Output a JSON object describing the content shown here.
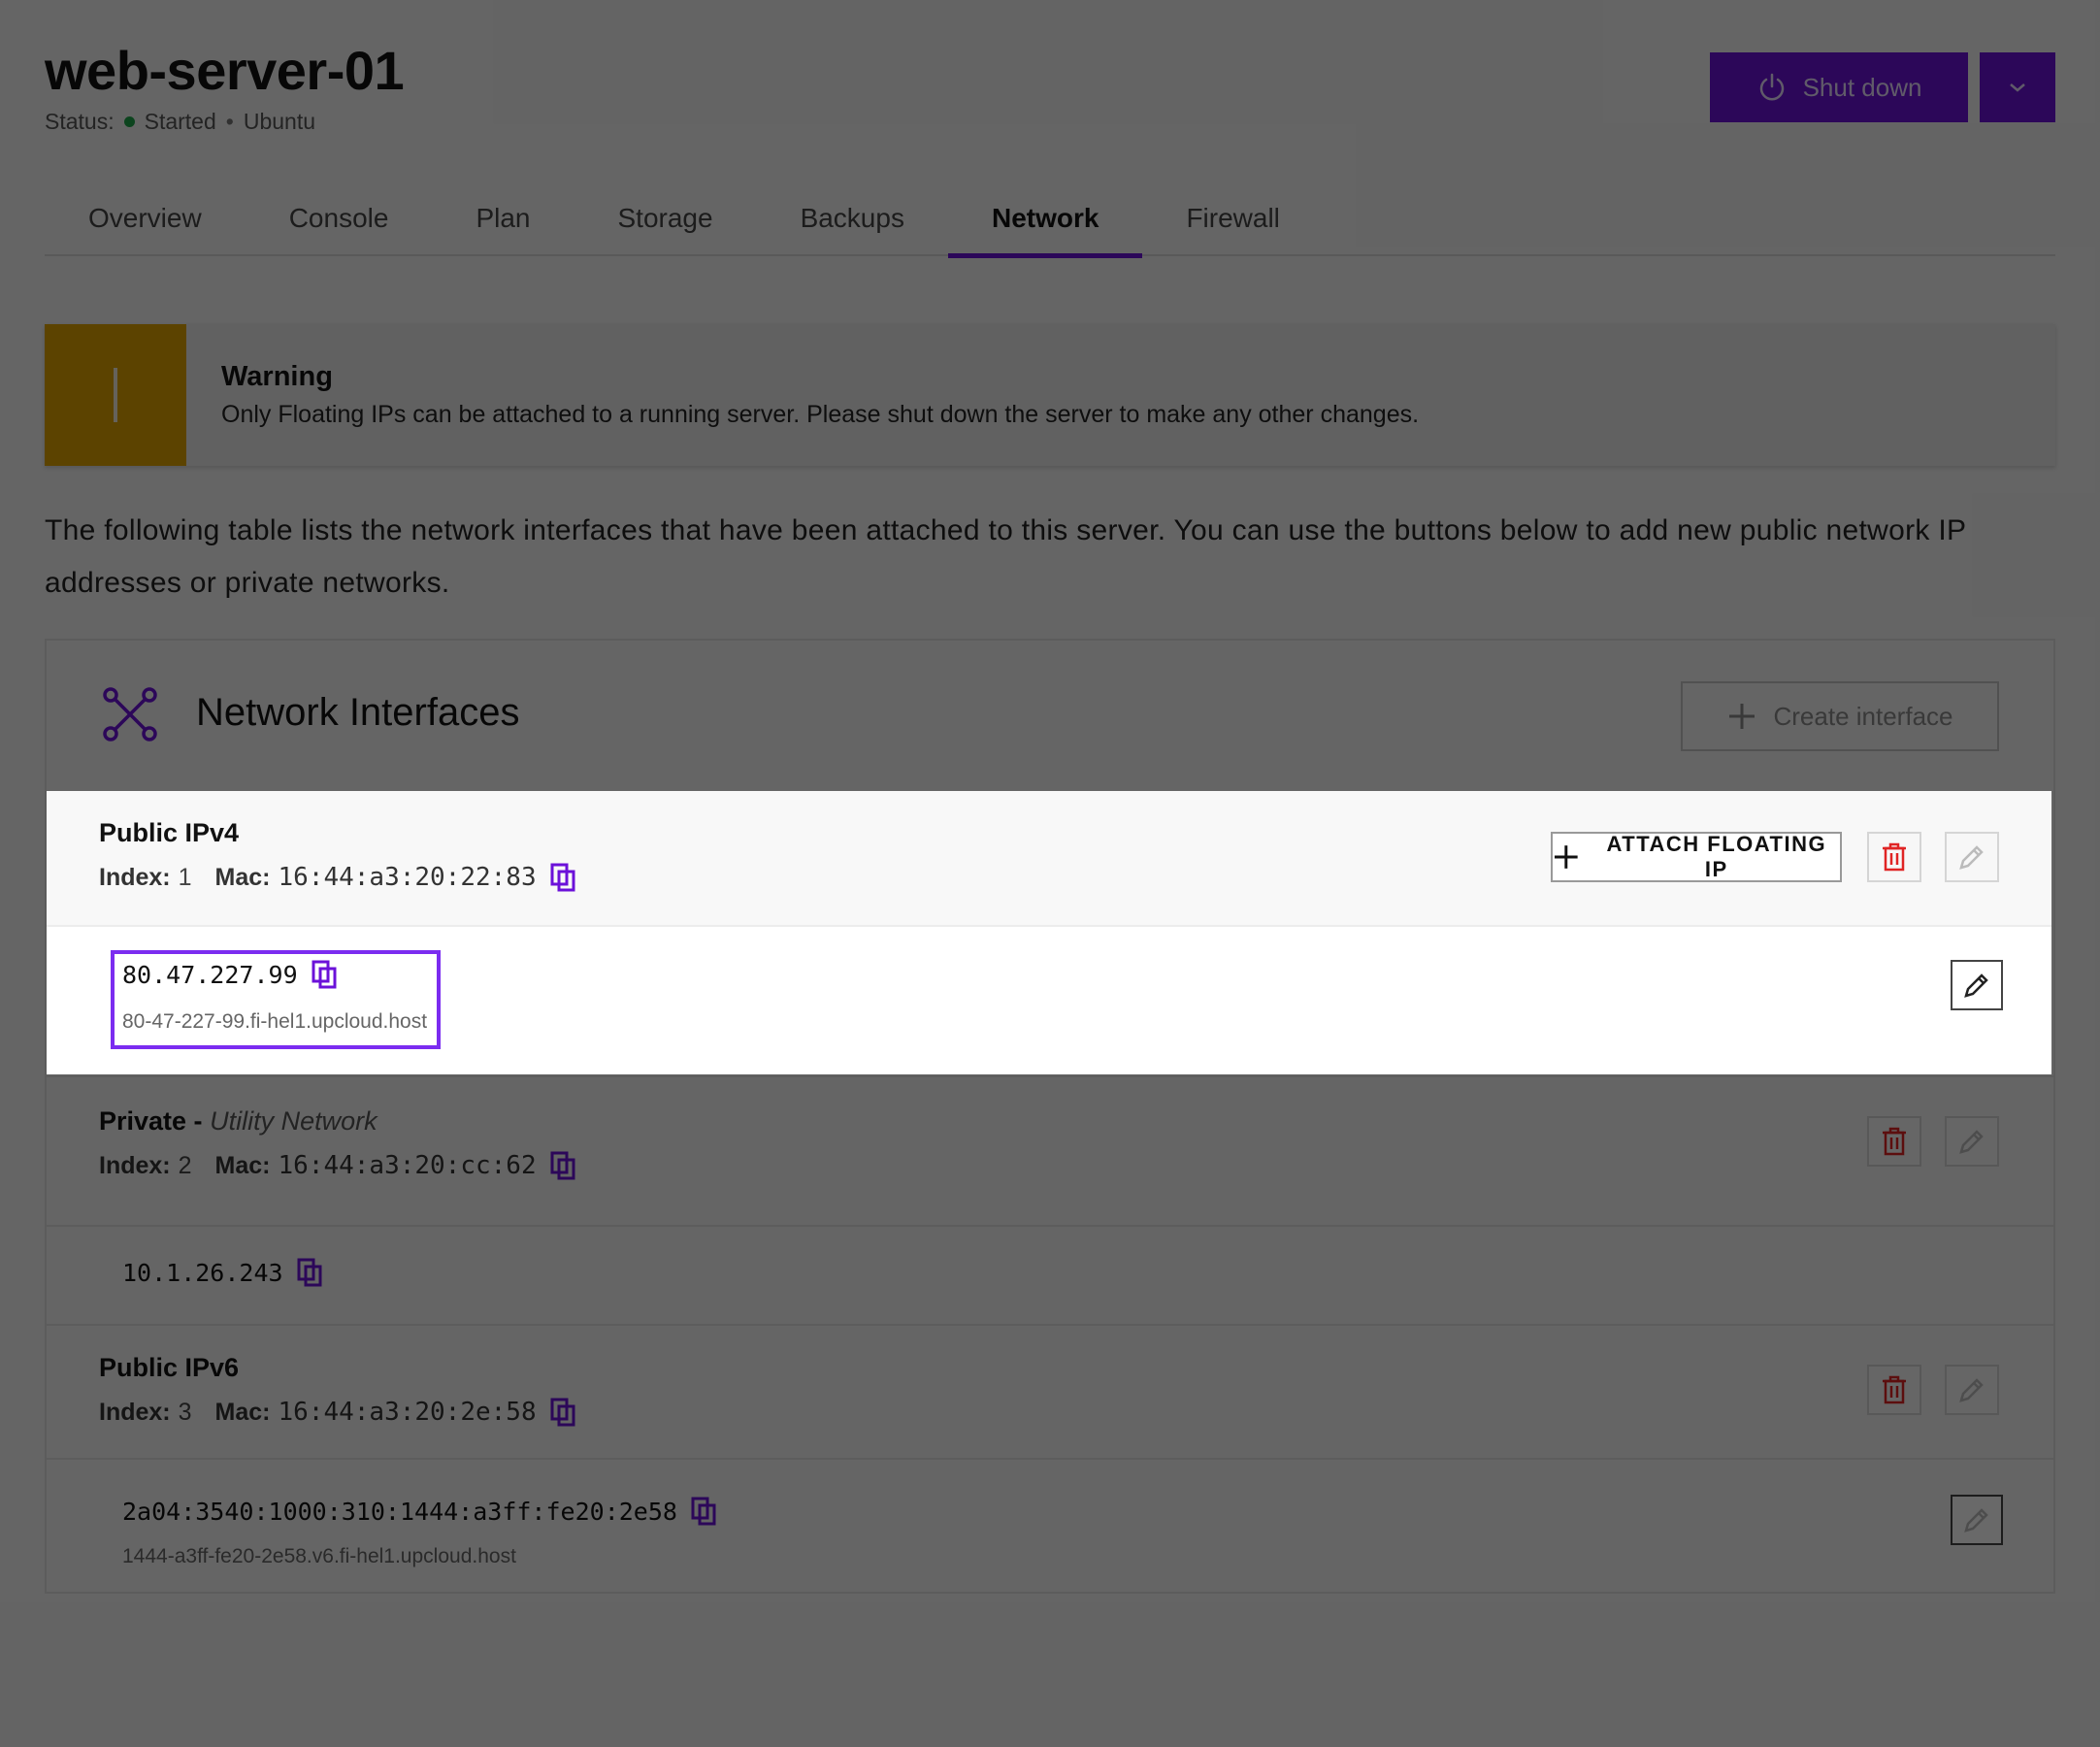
{
  "header": {
    "title": "web-server-01",
    "status_label": "Status:",
    "status_value": "Started",
    "status_separator": "•",
    "os": "Ubuntu",
    "shutdown_label": "Shut down",
    "status_color": "#1fa64a",
    "accent_color": "#6b11d9"
  },
  "tabs": [
    {
      "label": "Overview"
    },
    {
      "label": "Console"
    },
    {
      "label": "Plan"
    },
    {
      "label": "Storage"
    },
    {
      "label": "Backups"
    },
    {
      "label": "Network",
      "active": true
    },
    {
      "label": "Firewall"
    }
  ],
  "warning": {
    "title": "Warning",
    "message": "Only Floating IPs can be attached to a running server. Please shut down the server to make any other changes.",
    "color": "#e0a400"
  },
  "intro": "The following table lists the network interfaces that have been attached to this server. You can use the buttons below to add new public network IP addresses or private networks.",
  "network_card": {
    "title": "Network Interfaces",
    "create_label": "Create interface",
    "index_label": "Index:",
    "mac_label": "Mac:",
    "interfaces": [
      {
        "name": "Public IPv4",
        "index": "1",
        "mac": "16:44:a3:20:22:83",
        "attach_label": "ATTACH FLOATING IP",
        "ip": "80.47.227.99",
        "hostname": "80-47-227-99.fi-hel1.upcloud.host"
      },
      {
        "name": "Private -",
        "network": "Utility Network",
        "index": "2",
        "mac": "16:44:a3:20:cc:62",
        "ip": "10.1.26.243"
      },
      {
        "name": "Public IPv6",
        "index": "3",
        "mac": "16:44:a3:20:2e:58",
        "ip": "2a04:3540:1000:310:1444:a3ff:fe20:2e58",
        "hostname": "1444-a3ff-fe20-2e58.v6.fi-hel1.upcloud.host"
      }
    ]
  }
}
